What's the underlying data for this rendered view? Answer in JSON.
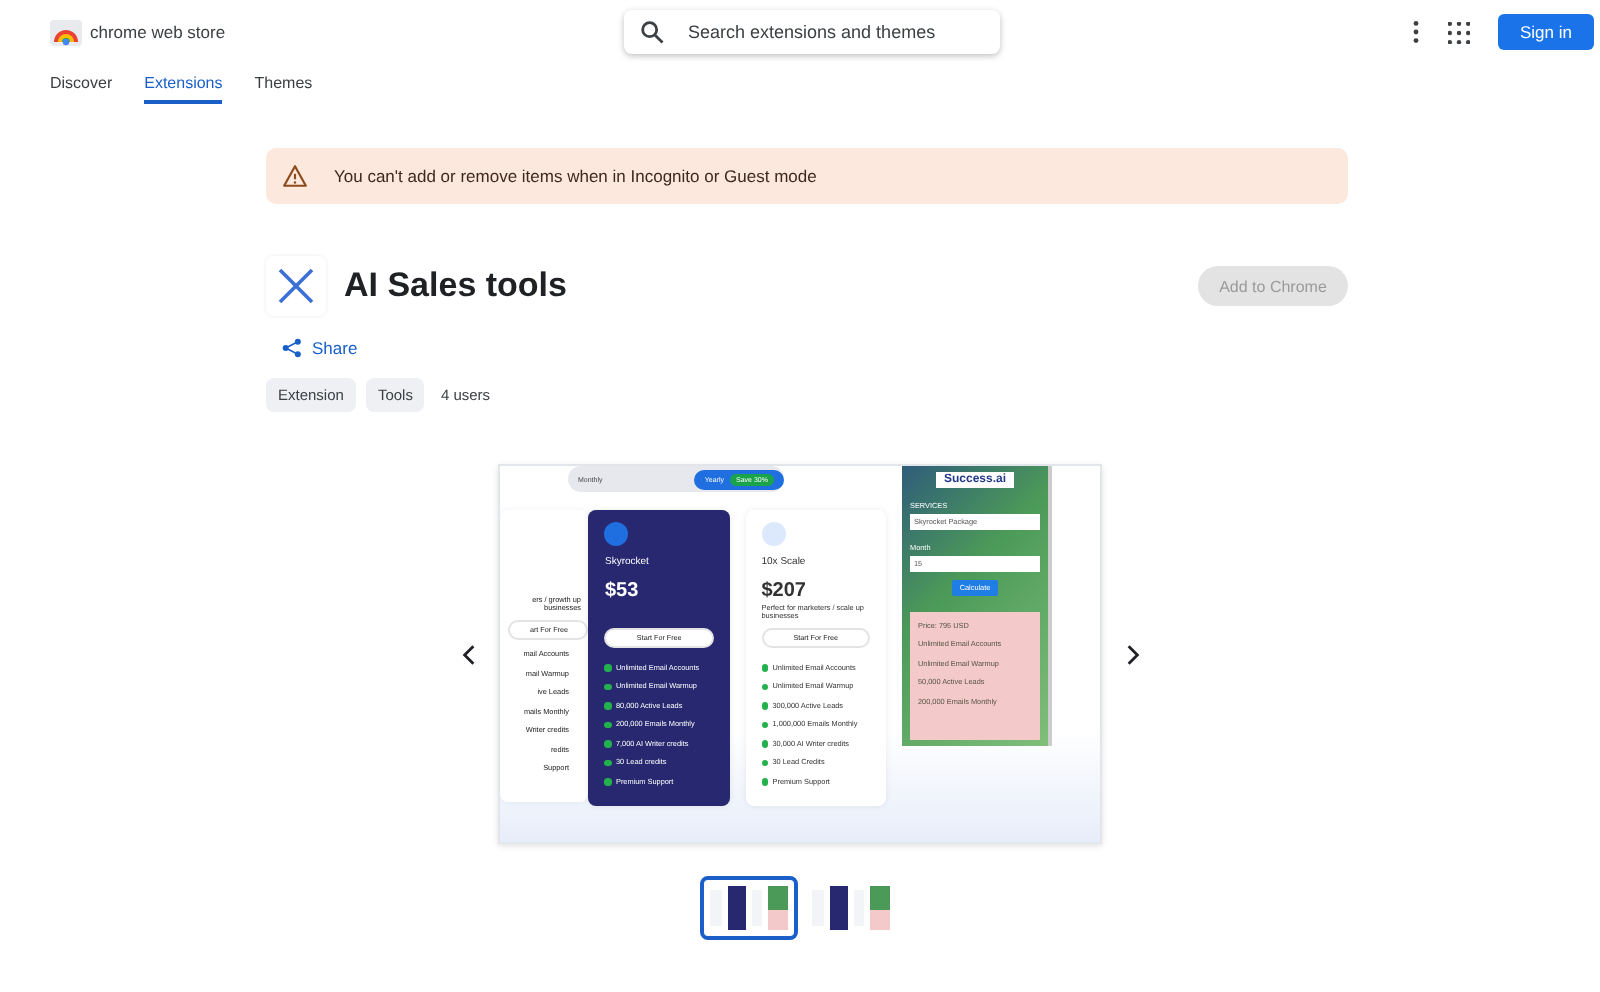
{
  "header": {
    "brand": "chrome web store",
    "search": {
      "placeholder": "Search extensions and themes"
    },
    "sign_in": "Sign in"
  },
  "nav": [
    {
      "label": "Discover",
      "selected": false
    },
    {
      "label": "Extensions",
      "selected": true
    },
    {
      "label": "Themes",
      "selected": false
    }
  ],
  "notice": "You can't add or remove items when in Incognito or Guest mode",
  "item": {
    "title": "AI Sales tools",
    "add_button": {
      "label": "Add to Chrome",
      "disabled": true
    },
    "share": "Share",
    "chips": [
      "Extension",
      "Tools"
    ],
    "users": "4 users"
  },
  "gallery": {
    "thumbnails": [
      {
        "selected": true
      },
      {
        "selected": false
      }
    ],
    "screenshot": {
      "toggle": [
        {
          "label": "Monthly",
          "selected": false
        },
        {
          "label": "Yearly",
          "selected": true
        }
      ],
      "save_badge": "Save 30%",
      "partial_plan": {
        "tagline": "ers / growth up businesses",
        "button": "art For Free",
        "features": [
          "mail Accounts",
          "mail Warmup",
          "ive Leads",
          "mails Monthly",
          "Writer credits",
          "redits",
          "Support"
        ]
      },
      "plans": [
        {
          "name": "Skyrocket",
          "price": "$53",
          "featured": true,
          "button": "Start For Free",
          "features": [
            "Unlimited Email Accounts",
            "Unlimited Email Warmup",
            "80,000 Active Leads",
            "200,000 Emails Monthly",
            "7,000 AI Writer credits",
            "30 Lead credits",
            "Premium Support"
          ]
        },
        {
          "name": "10x Scale",
          "price": "$207",
          "featured": false,
          "tagline": "Perfect for marketers / scale up businesses",
          "button": "Start For Free",
          "features": [
            "Unlimited Email Accounts",
            "Unlimited Email Warmup",
            "300,000 Active Leads",
            "1,000,000 Emails Monthly",
            "30,000 AI Writer credits",
            "30 Lead Credits",
            "Premium Support"
          ]
        }
      ],
      "calculator": {
        "logo": "Success.ai",
        "services_label": "SERVICES",
        "service": "Skyrocket Package",
        "month_label": "Month",
        "month": "15",
        "button": "Calculate",
        "results": [
          "Price: 795 USD",
          "Unlimited Email Accounts",
          "Unlimited Email Warmup",
          "50,000 Active Leads",
          "200,000 Emails Monthly"
        ]
      }
    }
  }
}
